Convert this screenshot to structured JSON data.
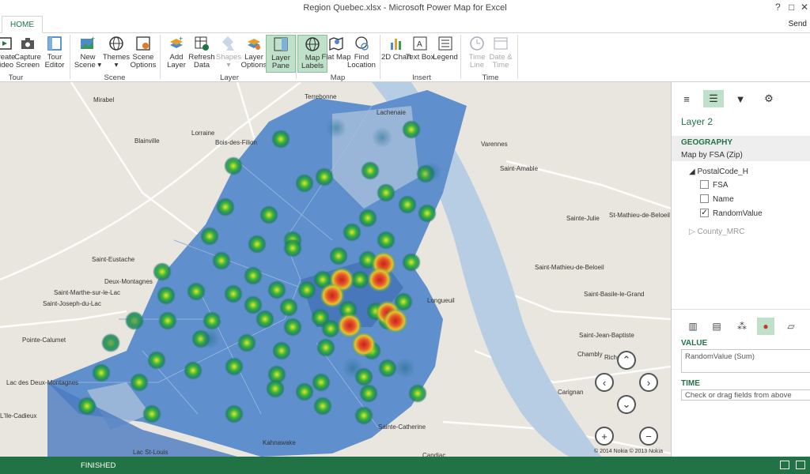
{
  "window": {
    "title": "Region Quebec.xlsx - Microsoft Power Map for Excel",
    "help": "?",
    "restore": "□",
    "close": "✕"
  },
  "tabs": {
    "home": "HOME",
    "send": "Send"
  },
  "ribbon": {
    "groups": [
      "Tour",
      "Scene",
      "Layer",
      "Map",
      "Insert",
      "Time"
    ],
    "buttons": [
      {
        "label": "Create Video",
        "icon": "video-icon"
      },
      {
        "label": "Capture Screen",
        "icon": "camera-icon"
      },
      {
        "label": "Tour Editor",
        "icon": "tour-editor-icon"
      },
      {
        "label": "New Scene",
        "icon": "new-scene-icon"
      },
      {
        "label": "Themes",
        "icon": "themes-icon"
      },
      {
        "label": "Scene Options",
        "icon": "scene-options-icon"
      },
      {
        "label": "Add Layer",
        "icon": "add-layer-icon"
      },
      {
        "label": "Refresh Data",
        "icon": "refresh-icon"
      },
      {
        "label": "Shapes",
        "icon": "shapes-icon"
      },
      {
        "label": "Layer Options",
        "icon": "layer-options-icon"
      },
      {
        "label": "Layer Pane",
        "icon": "layer-pane-icon"
      },
      {
        "label": "Map Labels",
        "icon": "map-labels-icon"
      },
      {
        "label": "Flat Map",
        "icon": "flat-map-icon"
      },
      {
        "label": "Find Location",
        "icon": "find-location-icon"
      },
      {
        "label": "2D Chart",
        "icon": "chart-icon"
      },
      {
        "label": "Text Box",
        "icon": "text-box-icon"
      },
      {
        "label": "Legend",
        "icon": "legend-icon"
      },
      {
        "label": "Time Line",
        "icon": "timeline-icon"
      },
      {
        "label": "Date & Time",
        "icon": "date-time-icon"
      }
    ]
  },
  "map": {
    "places": [
      "Terrebonne",
      "Lachenaie",
      "Mirabel",
      "Lorraine",
      "Blainville",
      "Bois-des-Filion",
      "Varennes",
      "Saint-Amable",
      "St-Mathieu-de-Beloeil",
      "Sainte-Julie",
      "Saint-Mathieu-de-Beloeil",
      "Saint-Eustache",
      "Deux-Montagnes",
      "Saint-Marthe-sur-le-Lac",
      "Saint-Joseph-du-Lac",
      "Pointe-Calumet",
      "Longueuil",
      "Saint-Basile-le-Grand",
      "Saint-Jean-Baptiste",
      "Chambly",
      "Richelieu",
      "Carignan",
      "L'Ile-Cadieux",
      "Kahnawake",
      "Sainte-Catherine",
      "Lac St-Louis",
      "Candiac",
      "Lac des Deux-Montagnes"
    ],
    "copyright": "© 2014 Nokia  © 2013 Nokia",
    "zoom_in": "+",
    "zoom_out": "−"
  },
  "pane": {
    "layer_title": "Layer 2",
    "geography_head": "GEOGRAPHY",
    "geography_sub": "Map by FSA (Zip)",
    "tree_root": "PostalCode_H",
    "fields": [
      {
        "label": "FSA",
        "checked": false
      },
      {
        "label": "Name",
        "checked": false
      },
      {
        "label": "RandomValue",
        "checked": true
      }
    ],
    "collapsed": "County_MRC",
    "value_head": "VALUE",
    "value_field": "RandomValue (Sum)",
    "time_head": "TIME",
    "time_placeholder": "Check or drag fields from above"
  },
  "status": {
    "text": "FINISHED"
  }
}
